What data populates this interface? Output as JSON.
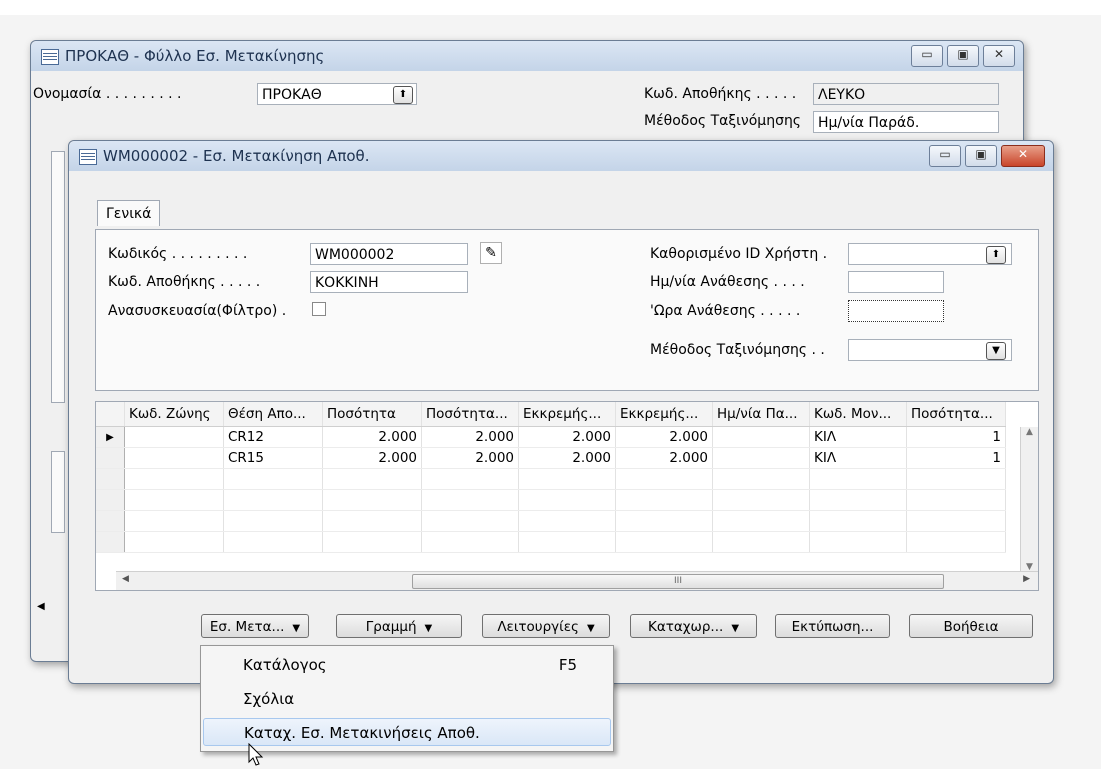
{
  "back_window": {
    "title": "ΠΡΟΚΑΘ - Φύλλο Εσ. Μετακίνησης",
    "name_label": "Ονομασία . . . . . . . . .",
    "name_value": "ΠΡΟΚΑΘ",
    "warehouse_label": "Κωδ. Αποθήκης . . . . .",
    "warehouse_value": "ΛΕΥΚΟ",
    "sort_label": "Μέθοδος Ταξινόμησης",
    "sort_value": "Ημ/νία Παράδ."
  },
  "front_window": {
    "title": "WM000002 - Εσ. Μετακίνηση Αποθ.",
    "tab_general": "Γενικά",
    "code_label": "Κωδικός . . . . . . . . .",
    "code_value": "WM000002",
    "warehouse_label": "Κωδ. Αποθήκης . . . . .",
    "warehouse_value": "ΚΟΚΚΙΝΗ",
    "repack_label": "Ανασυσκευασία(Φίλτρο) .",
    "assigned_user_label": "Καθορισμένο ID Χρήστη .",
    "assigned_date_label": "Ημ/νία Ανάθεσης . . . .",
    "assigned_time_label": "'Ωρα Ανάθεσης . . . . .",
    "sort_method_label": "Μέθοδος Ταξινόμησης . ."
  },
  "grid": {
    "columns": [
      "Κωδ. Ζώνης",
      "Θέση Απο...",
      "Ποσότητα",
      "Ποσότητα...",
      "Εκκρεμής...",
      "Εκκρεμής...",
      "Ημ/νία Πα...",
      "Κωδ. Μον...",
      "Ποσότητα..."
    ],
    "rows": [
      {
        "zone": "",
        "bin": "CR12",
        "qty": "2.000",
        "qty2": "2.000",
        "pend1": "2.000",
        "pend2": "2.000",
        "date": "",
        "uom": "ΚΙΛ",
        "qty3": "1"
      },
      {
        "zone": "",
        "bin": "CR15",
        "qty": "2.000",
        "qty2": "2.000",
        "pend1": "2.000",
        "pend2": "2.000",
        "date": "",
        "uom": "ΚΙΛ",
        "qty3": "1"
      }
    ],
    "scroll_grip": "III"
  },
  "buttons": {
    "movement": "Εσ. Μετα...",
    "line": "Γραμμή",
    "functions": "Λειτουργίες",
    "register": "Καταχωρ...",
    "print": "Εκτύπωση...",
    "help": "Βοήθεια"
  },
  "menu": {
    "items": [
      {
        "label": "Κατάλογος",
        "shortcut": "F5"
      },
      {
        "label": "Σχόλια",
        "shortcut": ""
      },
      {
        "label": "Καταχ. Εσ. Μετακινήσεις Αποθ.",
        "shortcut": ""
      }
    ]
  }
}
